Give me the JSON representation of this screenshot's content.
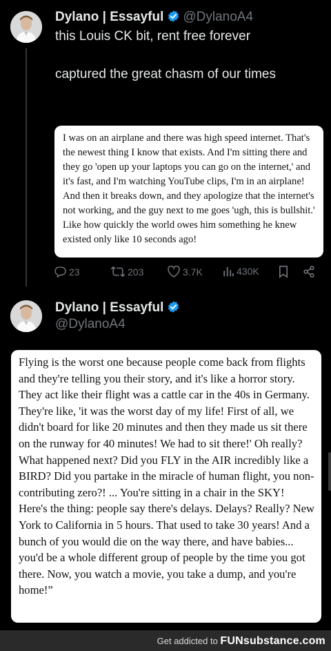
{
  "tweet1": {
    "display_name": "Dylano | Essayful",
    "handle": "@DylanoA4",
    "text_line1": "this Louis CK bit, rent free forever",
    "text_line2": "captured the great chasm of our times",
    "quote": "I was on an airplane and there was high speed internet. That's the newest thing I know that exists. And I'm sitting there and they go 'open up your laptops you can go on the internet,' and it's fast, and I'm watching YouTube clips, I'm in an airplane! And then it breaks down, and they apologize that the internet's not working, and the guy next to me goes 'ugh, this is bullshit.' Like how quickly the world owes him something he knew existed only like 10 seconds ago!",
    "replies": "23",
    "reposts": "203",
    "likes": "3.7K",
    "views": "430K"
  },
  "tweet2": {
    "display_name": "Dylano | Essayful",
    "handle": "@DylanoA4",
    "quote": "Flying is the worst one because people come back from flights and they're telling you their story, and it's like a horror story. They act like their flight was a cattle car in the 40s in Germany. They're like, 'it was the worst day of my life! First of all, we didn't board for like 20 minutes and then they made us sit there on the runway for 40 minutes! We had to sit there!' Oh really? What happened next? Did you FLY in the AIR incredibly like a BIRD? Did you partake in the miracle of human flight, you non-contributing zero?! ... You're sitting in a chair in the SKY! Here's the thing: people say there's delays. Delays? Really? New York to California in 5 hours. That used to take 30 years! And a bunch of you would die on the way there, and have babies... you'd be a whole different group of people by the time you got there. Now, you watch a movie, you take a dump, and you're home!”"
  },
  "footer": {
    "prefix": "Get addicted to",
    "brand": "FUNsubstance.com"
  },
  "colors": {
    "background": "#000000",
    "verified": "#1d9bf0",
    "muted": "#71767b",
    "text": "#e7e9ea"
  }
}
